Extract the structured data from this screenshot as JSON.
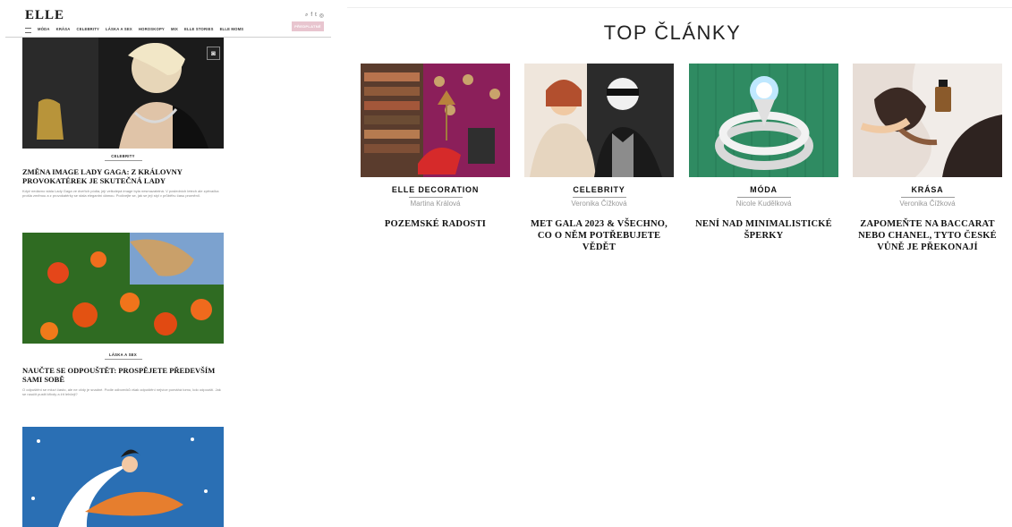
{
  "left": {
    "logo": "ELLE",
    "nav": [
      "MÓDA",
      "KRÁSA",
      "CELEBRITY",
      "LÁSKA A SEX",
      "HOROSKOPY",
      "MIX",
      "ELLE STORIES",
      "ELLE MOMS"
    ],
    "subscribe_label": "PŘEDPLATNÉ",
    "articles": [
      {
        "tag": "CELEBRITY",
        "title": "ZMĚNA IMAGE LADY GAGA: Z KRÁLOVNY PROVOKATÉREK JE SKUTEČNÁ LADY",
        "excerpt": "Když nedávno stála Lady Gaga ve dveřích pódia, její velkolepá image byla nesmazatelná. V posledních letech ale zpěvačka prošla změnou a z provokatérky se stala elegantní dámou. Podívejte se, jak se její styl v průběhu času proměnil."
      },
      {
        "tag": "LÁSKA A SEX",
        "title": "NAUČTE SE ODPOUŠTĚT: PROSPĚJETE PŘEDEVŠÍM SAMI SOBĚ",
        "excerpt": "O odpuštění se mluví často, ale ne vždy je snadné. Podle odborníků však odpuštění nejvíce pomáhá tomu, kdo odpouští. Jak se naučit pustit křivdy a žít lehčeji?"
      }
    ]
  },
  "right": {
    "section_title": "TOP ČLÁNKY",
    "cards": [
      {
        "tag": "ELLE DECORATION",
        "author": "Martina Králová",
        "title": "POZEMSKÉ RADOSTI"
      },
      {
        "tag": "CELEBRITY",
        "author": "Veronika Čížková",
        "title": "MET GALA 2023 & VŠECHNO, CO O NĚM POTŘEBUJETE VĚDĚT"
      },
      {
        "tag": "MÓDA",
        "author": "Nicole Kudělková",
        "title": "NENÍ NAD MINIMALISTICKÉ ŠPERKY"
      },
      {
        "tag": "KRÁSA",
        "author": "Veronika Čížková",
        "title": "ZAPOMEŇTE NA BACCARAT NEBO CHANEL, TYTO ČESKÉ VŮNĚ JE PŘEKONAJÍ"
      }
    ]
  }
}
